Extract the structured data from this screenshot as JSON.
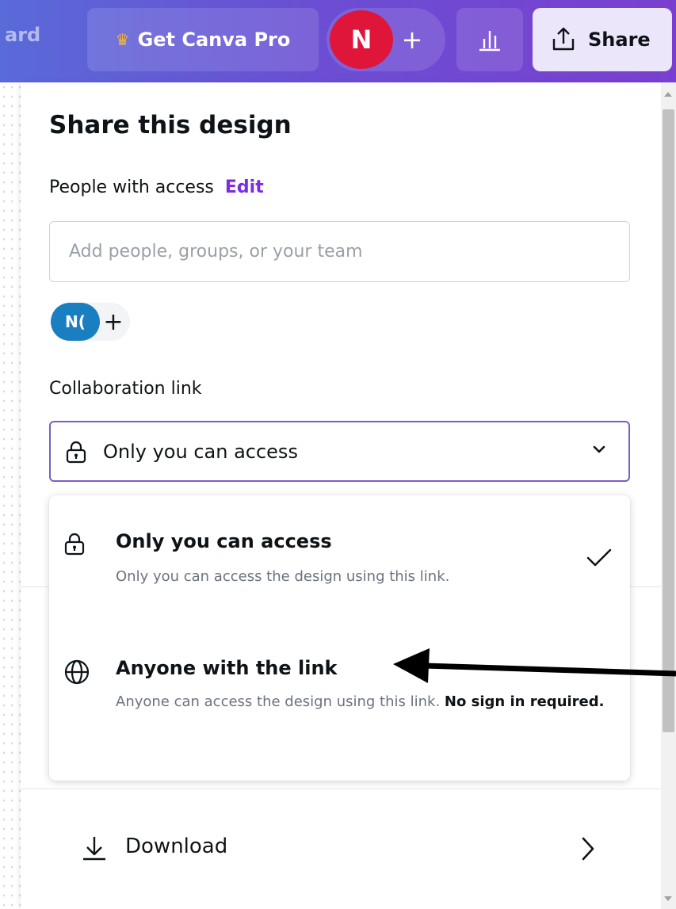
{
  "topbar": {
    "crumb": "ard",
    "pro_label": "Get Canva Pro",
    "avatar_initial": "N",
    "add_symbol": "+",
    "share_label": "Share",
    "colors": {
      "accent": "#7d2ae8",
      "avatar": "#e0153a",
      "crown": "#f5b83a"
    }
  },
  "panel": {
    "title": "Share this design",
    "people_label": "People with access",
    "edit_label": "Edit",
    "add_placeholder": "Add people, groups, or your team",
    "member_initials": "N(",
    "member_add": "+",
    "collab_label": "Collaboration link",
    "collab_selected": "Only you can access"
  },
  "dropdown": {
    "options": [
      {
        "title": "Only you can access",
        "desc": "Only you can access the design using this link.",
        "icon": "lock-icon",
        "selected": true
      },
      {
        "title": "Anyone with the link",
        "desc": "Anyone can access the design using this link.",
        "desc_bold": "No sign in required.",
        "icon": "globe-icon",
        "selected": false
      }
    ]
  },
  "download": {
    "label": "Download"
  }
}
